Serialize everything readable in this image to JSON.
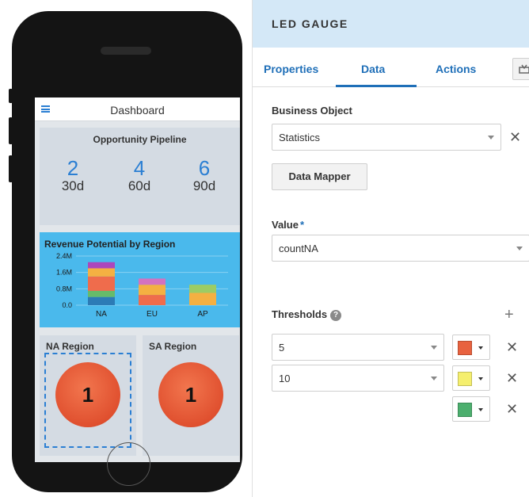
{
  "phone": {
    "header_title": "Dashboard",
    "pipeline": {
      "title": "Opportunity Pipeline",
      "items": [
        {
          "count": "2",
          "period": "30d"
        },
        {
          "count": "4",
          "period": "60d"
        },
        {
          "count": "6",
          "period": "90d"
        }
      ]
    },
    "revenue": {
      "title": "Revenue Potential by Region"
    },
    "regions": [
      {
        "title": "NA Region",
        "value": "1"
      },
      {
        "title": "SA Region",
        "value": "1"
      }
    ]
  },
  "chart_data": {
    "type": "bar",
    "stacked": true,
    "title": "Revenue Potential by Region",
    "categories": [
      "NA",
      "EU",
      "AP"
    ],
    "y_ticks": [
      "0.0",
      "0.8M",
      "1.6M",
      "2.4M"
    ],
    "ylim": [
      0,
      2400000
    ],
    "series": [
      {
        "color": "#2c7bb6",
        "values": [
          400000,
          0,
          0
        ]
      },
      {
        "color": "#66bb6a",
        "values": [
          300000,
          0,
          0
        ]
      },
      {
        "color": "#ef6c4c",
        "values": [
          700000,
          500000,
          0
        ]
      },
      {
        "color": "#f4b042",
        "values": [
          400000,
          500000,
          600000
        ]
      },
      {
        "color": "#ab47bc",
        "values": [
          300000,
          0,
          0
        ]
      },
      {
        "color": "#d372c0",
        "values": [
          0,
          300000,
          0
        ]
      },
      {
        "color": "#9ccc65",
        "values": [
          0,
          0,
          400000
        ]
      }
    ]
  },
  "panel": {
    "title": "LED GAUGE",
    "tabs": [
      "Properties",
      "Data",
      "Actions"
    ],
    "active_tab": "Data",
    "business_object_label": "Business Object",
    "business_object_value": "Statistics",
    "data_mapper_label": "Data Mapper",
    "value_label": "Value",
    "value_required": "*",
    "value_value": "countNA",
    "thresholds_label": "Thresholds",
    "thresholds": [
      {
        "value": "5",
        "color": "#e8623f"
      },
      {
        "value": "10",
        "color": "#f5ef6e"
      },
      {
        "value": "",
        "color": "#4caf6e"
      }
    ]
  },
  "icons": {
    "close": "✕",
    "plus": "+",
    "help": "?"
  }
}
